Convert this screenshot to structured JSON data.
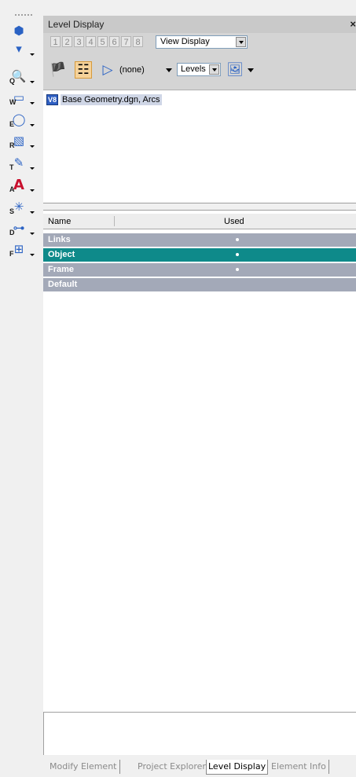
{
  "toolbar": {
    "tools": [
      {
        "icon": "element-selection-icon",
        "glyph": "⬢",
        "sub": ""
      },
      {
        "icon": "selection-dropdown-icon",
        "glyph": "▾",
        "sub": ""
      },
      {
        "icon": "query-tool-icon",
        "glyph": "🔍",
        "sub": "Q"
      },
      {
        "icon": "window-tool-icon",
        "glyph": "▭",
        "sub": "W"
      },
      {
        "icon": "ellipse-tool-icon",
        "glyph": "◯",
        "sub": "E"
      },
      {
        "icon": "region-tool-icon",
        "glyph": "▧",
        "sub": "R"
      },
      {
        "icon": "text-edit-tool-icon",
        "glyph": "✎",
        "sub": "T"
      },
      {
        "icon": "text-tool-icon",
        "glyph": "A",
        "sub": "A"
      },
      {
        "icon": "snap-tool-icon",
        "glyph": "✳",
        "sub": "S"
      },
      {
        "icon": "dimension-tool-icon",
        "glyph": "⊶",
        "sub": "D"
      },
      {
        "icon": "fence-tool-icon",
        "glyph": "⊞",
        "sub": "F"
      }
    ]
  },
  "panel": {
    "title": "Level Display",
    "views": [
      "1",
      "2",
      "3",
      "4",
      "5",
      "6",
      "7",
      "8"
    ],
    "view_display": "View Display",
    "filter": "(none)",
    "levels_select": "Levels",
    "tree_item": "Base Geometry.dgn, Arcs",
    "tree_icon": "V8"
  },
  "list": {
    "columns": {
      "name": "Name",
      "used": "Used"
    },
    "rows": [
      {
        "name": "Links",
        "used": true,
        "selected": false
      },
      {
        "name": "Object",
        "used": true,
        "selected": true
      },
      {
        "name": "Frame",
        "used": true,
        "selected": false
      },
      {
        "name": "Default",
        "used": false,
        "selected": false
      }
    ]
  },
  "tabs": [
    {
      "label": "Modify Element",
      "active": false
    },
    {
      "label": "Project Explorer",
      "active": false
    },
    {
      "label": "Level Display",
      "active": true
    },
    {
      "label": "Element Info",
      "active": false
    }
  ],
  "colors": {
    "selected_row": "#0e8a8a",
    "level_row": "#a3a9b8",
    "accent": "#2a62c4"
  }
}
